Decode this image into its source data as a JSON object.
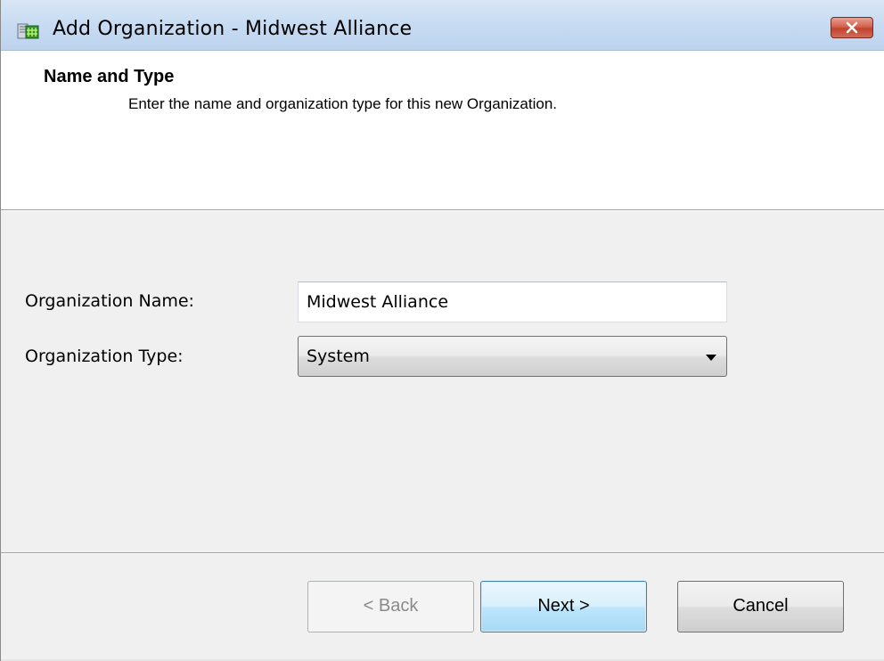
{
  "window": {
    "title": "Add Organization - Midwest Alliance",
    "icon": "organization-app-icon",
    "close_icon": "close-icon"
  },
  "header": {
    "title": "Name and Type",
    "subtitle": "Enter the name and organization type for this new Organization."
  },
  "form": {
    "org_name_label": "Organization Name:",
    "org_name_value": "Midwest Alliance",
    "org_type_label": "Organization Type:",
    "org_type_value": "System"
  },
  "buttons": {
    "back": "< Back",
    "next": "Next >",
    "cancel": "Cancel"
  },
  "colors": {
    "titlebar": "#c8dcf2",
    "close_button": "#c1432e",
    "default_button_border": "#3c7fb1",
    "dialog_background": "#f0f0f0"
  }
}
